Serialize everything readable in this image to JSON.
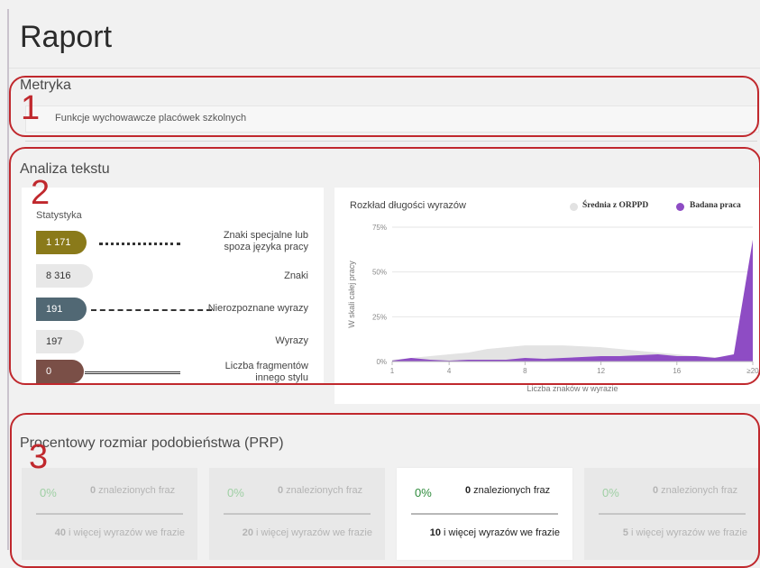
{
  "page": {
    "title": "Raport"
  },
  "annotations": [
    "1",
    "2",
    "3"
  ],
  "metric": {
    "heading": "Metryka",
    "value": "Funkcje wychowawcze placówek szkolnych"
  },
  "analysis": {
    "heading": "Analiza tekstu",
    "stats": {
      "title": "Statystyka",
      "items": [
        {
          "value": "1 171",
          "label_line1": "Znaki specjalne lub",
          "label_line2": "spoza języka pracy",
          "pill_color": "#8a7a1a",
          "text_color": "#ffffff"
        },
        {
          "value": "8 316",
          "label_line1": "Znaki",
          "label_line2": "",
          "pill_color": "#e8e8e8",
          "text_color": "#333333"
        },
        {
          "value": "191",
          "label_line1": "Nierozpoznane wyrazy",
          "label_line2": "",
          "pill_color": "#516874",
          "text_color": "#ffffff"
        },
        {
          "value": "197",
          "label_line1": "Wyrazy",
          "label_line2": "",
          "pill_color": "#e8e8e8",
          "text_color": "#333333"
        },
        {
          "value": "0",
          "label_line1": "Liczba fragmentów",
          "label_line2": "innego stylu",
          "pill_color": "#7a4f47",
          "text_color": "#ffffff"
        }
      ]
    },
    "chart": {
      "title": "Rozkład długości wyrazów",
      "legend": [
        {
          "name": "Średnia z ORPPD",
          "color": "#e2e2e2"
        },
        {
          "name": "Badana praca",
          "color": "#8e4cc4"
        }
      ]
    }
  },
  "chart_data": {
    "type": "area",
    "title": "Rozkład długości wyrazów",
    "xlabel": "Liczba znaków w wyrazie",
    "ylabel": "W skali całej pracy",
    "x": [
      1,
      2,
      3,
      4,
      5,
      6,
      7,
      8,
      9,
      10,
      11,
      12,
      13,
      14,
      15,
      16,
      17,
      18,
      19,
      20
    ],
    "x_ticks": [
      "1",
      "4",
      "8",
      "12",
      "16",
      "≥20"
    ],
    "y_ticks": [
      "0%",
      "25%",
      "50%",
      "75%"
    ],
    "ylim": [
      0,
      75
    ],
    "grid": true,
    "legend_position": "top-right",
    "series": [
      {
        "name": "Średnia z ORPPD",
        "values": [
          1,
          2,
          3,
          4,
          5,
          7,
          8,
          9,
          9,
          9,
          8.5,
          8,
          7,
          6,
          5,
          4,
          3,
          2.5,
          2,
          1.5
        ]
      },
      {
        "name": "Badana praca",
        "values": [
          0.5,
          2,
          1,
          0.5,
          1,
          1,
          1,
          2,
          1.5,
          2,
          2.5,
          3,
          3,
          3.5,
          4,
          3,
          3,
          2,
          4,
          68
        ]
      }
    ]
  },
  "prp": {
    "heading": "Procentowy rozmiar podobieństwa (PRP)",
    "cards": [
      {
        "percent": "0%",
        "count": "0",
        "found_text": " znalezionych fraz",
        "threshold": "40",
        "sub_text": " i więcej wyrazów we frazie",
        "active": false
      },
      {
        "percent": "0%",
        "count": "0",
        "found_text": " znalezionych fraz",
        "threshold": "20",
        "sub_text": " i więcej wyrazów we frazie",
        "active": false
      },
      {
        "percent": "0%",
        "count": "0",
        "found_text": " znalezionych fraz",
        "threshold": "10",
        "sub_text": " i więcej wyrazów we frazie",
        "active": true
      },
      {
        "percent": "0%",
        "count": "0",
        "found_text": " znalezionych fraz",
        "threshold": "5",
        "sub_text": " i więcej wyrazów we frazie",
        "active": false
      }
    ]
  }
}
